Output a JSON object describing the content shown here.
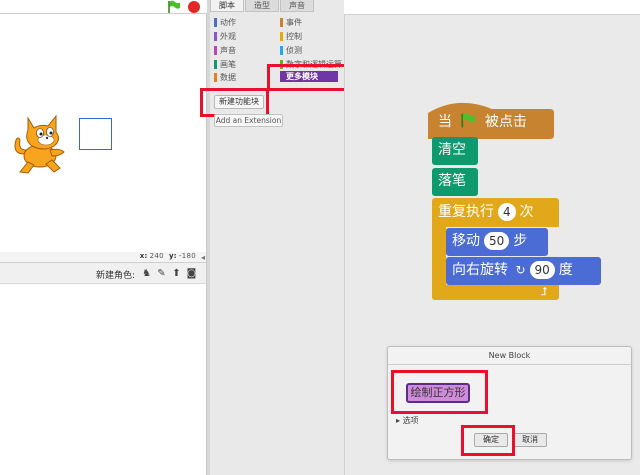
{
  "palette": {
    "tabs": [
      "脚本",
      "造型",
      "声音"
    ],
    "categories_left": [
      {
        "label": "动作",
        "color": "#4a6cd4"
      },
      {
        "label": "外观",
        "color": "#8a55d7"
      },
      {
        "label": "声音",
        "color": "#bb42c3"
      },
      {
        "label": "画笔",
        "color": "#0e9a6c"
      },
      {
        "label": "数据",
        "color": "#ee7d16"
      }
    ],
    "categories_right": [
      {
        "label": "事件",
        "color": "#c88330"
      },
      {
        "label": "控制",
        "color": "#e1a91a"
      },
      {
        "label": "侦测",
        "color": "#2ca5e2"
      },
      {
        "label": "数字和逻辑运算",
        "color": "#5cb712"
      }
    ],
    "more_blocks": "更多模块",
    "make_block": "新建功能块",
    "add_extension": "Add an Extension"
  },
  "stage": {
    "coord_x_label": "x:",
    "coord_x": "240",
    "coord_y_label": "y:",
    "coord_y": "-180",
    "new_sprite": "新建角色:"
  },
  "script": {
    "hat": {
      "when": "当",
      "clicked": "被点击"
    },
    "clear": "清空",
    "pen_down": "落笔",
    "repeat": {
      "label": "重复执行",
      "count": "4",
      "suffix": "次"
    },
    "move": {
      "label": "移动",
      "steps": "50",
      "suffix": "步"
    },
    "turn": {
      "label": "向右旋转",
      "degrees": "90",
      "suffix": "度"
    }
  },
  "dialog": {
    "title": "New Block",
    "block_name": "绘制正方形",
    "options": "选项",
    "ok": "确定",
    "cancel": "取消"
  },
  "colors": {
    "highlight": "#e8102e",
    "more_blocks": "#6e36a6",
    "event": "#c88330",
    "pen": "#0e9a6c",
    "control": "#e1a91a",
    "motion": "#4a6cd4"
  }
}
